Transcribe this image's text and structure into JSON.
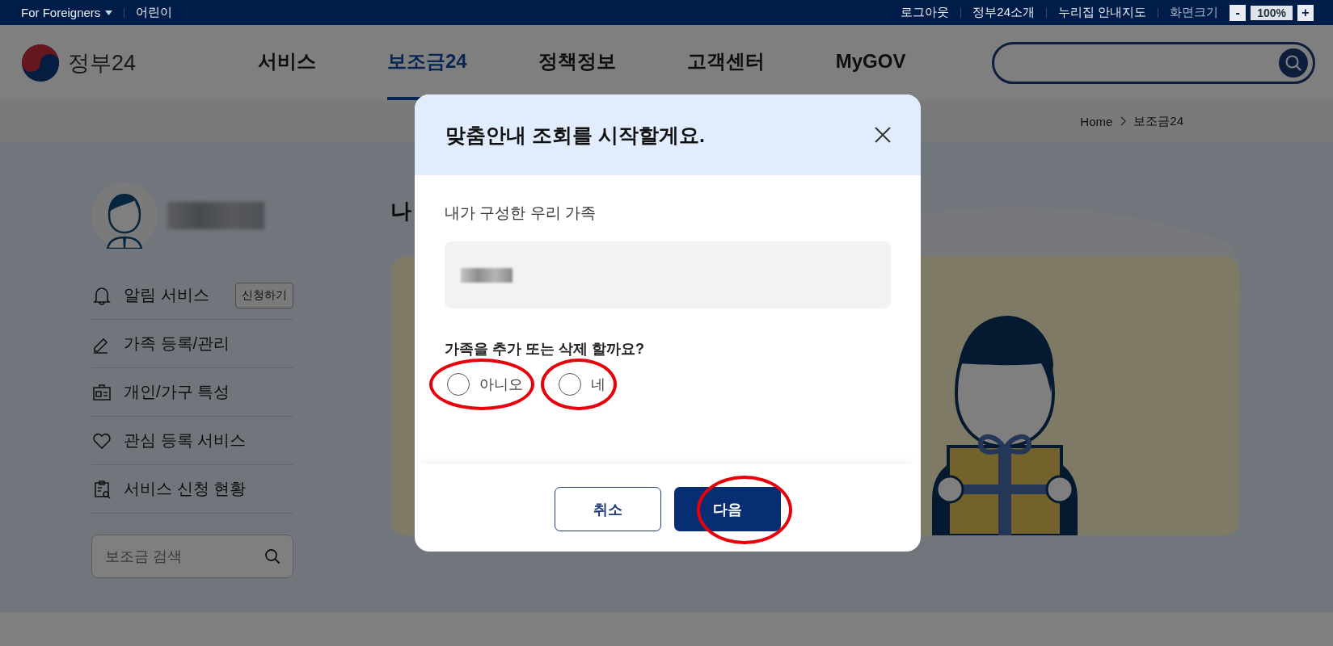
{
  "top_bar": {
    "left_links": [
      {
        "label": "For Foreigners",
        "has_menu": true
      },
      {
        "label": "어린이",
        "has_menu": false
      }
    ],
    "right_links": [
      "로그아웃",
      "정부24소개",
      "누리집 안내지도"
    ],
    "zoom": {
      "label": "화면크기",
      "decrease": "-",
      "value": "100%",
      "increase": "+"
    }
  },
  "header": {
    "logo_text": "정부24",
    "nav": [
      {
        "label": "서비스",
        "selected": false
      },
      {
        "label": "보조금24",
        "selected": true
      },
      {
        "label": "정책정보",
        "selected": false
      },
      {
        "label": "고객센터",
        "selected": false
      },
      {
        "label": "MyGOV",
        "selected": false
      }
    ]
  },
  "breadcrumb": [
    "Home",
    "보조금24"
  ],
  "sidebar": {
    "menu": [
      {
        "label": "알림 서비스",
        "action": "신청하기"
      },
      {
        "label": "가족 등록/관리"
      },
      {
        "label": "개인/가구 특성"
      },
      {
        "label": "관심 등록 서비스"
      },
      {
        "label": "서비스 신청 현황"
      }
    ],
    "search": {
      "placeholder": "보조금 검색"
    }
  },
  "main": {
    "heading": "나"
  },
  "dialog": {
    "title": "맞춤안내 조회를 시작할게요.",
    "family_label": "내가 구성한 우리 가족",
    "question": "가족을 추가 또는 삭제 할까요?",
    "options": [
      {
        "label": "아니오",
        "selected": false,
        "circled": true
      },
      {
        "label": "네",
        "selected": false,
        "circled": true
      }
    ],
    "buttons": [
      {
        "label": "취소",
        "kind": "secondary",
        "circled": false
      },
      {
        "label": "다음",
        "kind": "primary",
        "circled": true
      }
    ]
  }
}
